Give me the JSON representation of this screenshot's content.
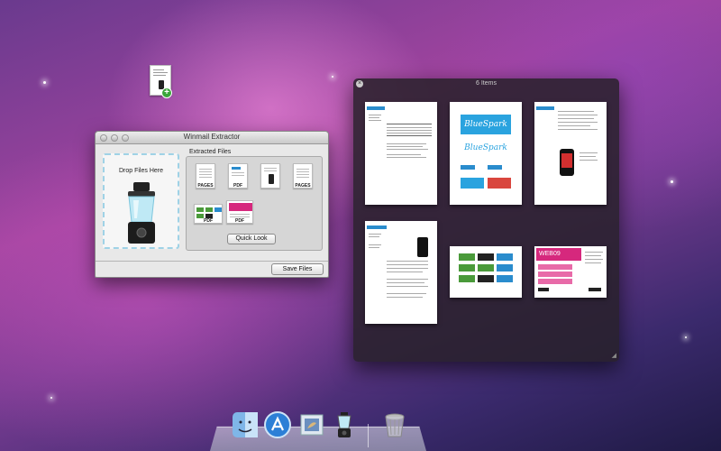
{
  "desktop": {
    "file_icon": "document-icon"
  },
  "winmail": {
    "title": "Winmail Extractor",
    "drop_label": "Drop Files Here",
    "extracted_label": "Extracted Files",
    "files": [
      {
        "type": "PAGES"
      },
      {
        "type": "PDF"
      },
      {
        "type": ""
      },
      {
        "type": "PAGES"
      },
      {
        "type": "PDF"
      },
      {
        "type": "PDF"
      }
    ],
    "quick_look_label": "Quick Look",
    "save_label": "Save Files"
  },
  "quicklook": {
    "title": "6 Items",
    "tiles": [
      "BlueSpark",
      "BlueSpark",
      "",
      "",
      "",
      "WEB09"
    ]
  },
  "dock": {
    "items": [
      "finder-icon",
      "app-store-icon",
      "mail-icon",
      "winmail-extractor-icon",
      "trash-icon"
    ]
  },
  "colors": {
    "accent_blue": "#2a8ccd",
    "pink": "#d6287d"
  }
}
